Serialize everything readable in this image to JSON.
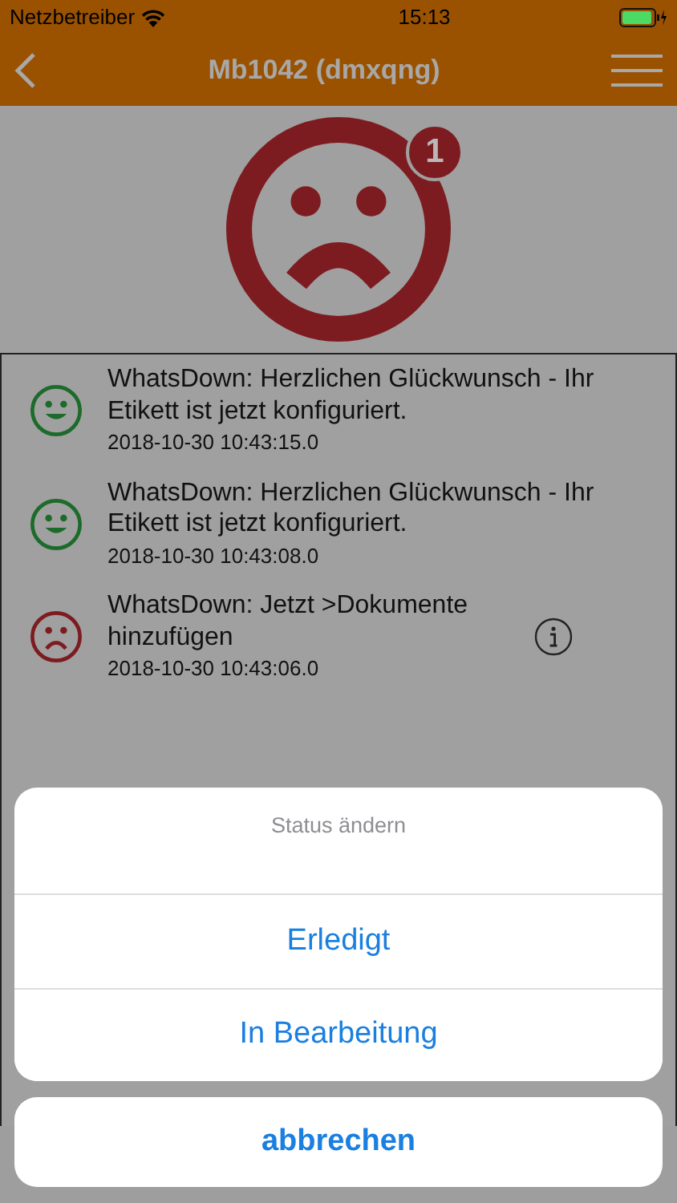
{
  "status_bar": {
    "carrier": "Netzbetreiber",
    "time": "15:13"
  },
  "nav": {
    "title": "Mb1042 (dmxqng)"
  },
  "status_badge": {
    "kind": "sad",
    "count": "1"
  },
  "messages": [
    {
      "kind": "happy",
      "text": "WhatsDown: Herzlichen Glückwunsch - Ihr Etikett ist jetzt konfiguriert.",
      "time": "2018-10-30 10:43:15.0",
      "info": false
    },
    {
      "kind": "happy",
      "text": "WhatsDown: Herzlichen Glückwunsch - Ihr Etikett ist jetzt konfiguriert.",
      "time": "2018-10-30 10:43:08.0",
      "info": false
    },
    {
      "kind": "sad",
      "text": "WhatsDown: Jetzt >Dokumente hinzufügen",
      "time": "2018-10-30 10:43:06.0",
      "info": true
    }
  ],
  "action_sheet": {
    "title": "Status ändern",
    "actions": [
      "Erledigt",
      "In Bearbeitung"
    ],
    "cancel": "abbrechen"
  }
}
